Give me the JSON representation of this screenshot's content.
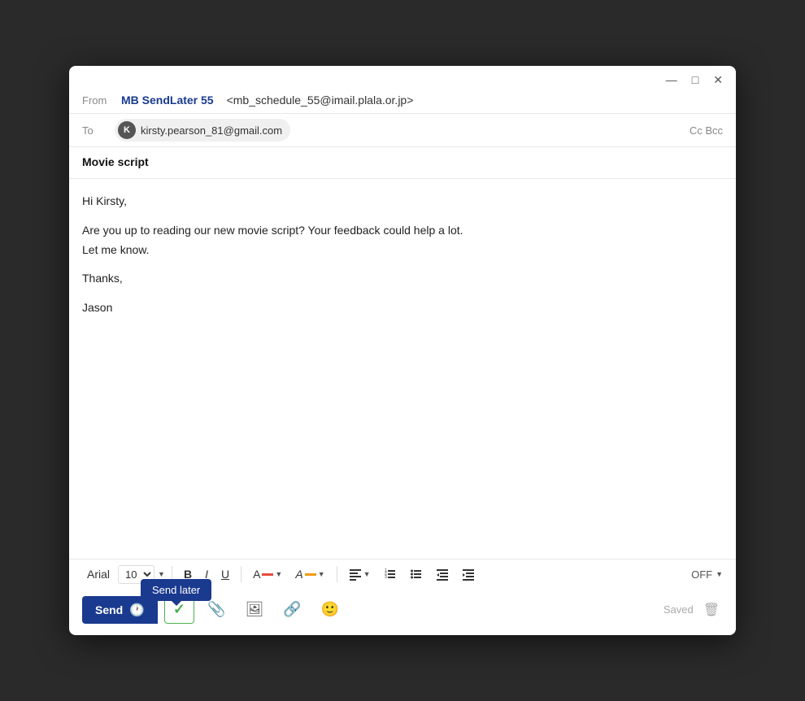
{
  "window": {
    "titlebar_controls": {
      "minimize": "—",
      "maximize": "□",
      "close": "✕"
    }
  },
  "header": {
    "from_label": "From",
    "from_name": "MB SendLater 55",
    "from_email": "<mb_schedule_55@imail.plala.or.jp>",
    "to_label": "To",
    "recipient_initial": "K",
    "recipient_email": "kirsty.pearson_81@gmail.com",
    "cc_bcc": "Cc Bcc"
  },
  "compose": {
    "subject": "Movie script",
    "body_line1": "Hi Kirsty,",
    "body_line2": "Are you up to reading our new movie script? Your feedback could help a lot.",
    "body_line3": "Let me know.",
    "body_line4": "Thanks,",
    "body_line5": "Jason"
  },
  "toolbar": {
    "font": "Arial",
    "font_size": "10",
    "bold": "B",
    "italic": "I",
    "underline": "U",
    "off_label": "OFF"
  },
  "action_bar": {
    "send_label": "Send",
    "tooltip_label": "Send later",
    "saved_label": "Saved"
  }
}
